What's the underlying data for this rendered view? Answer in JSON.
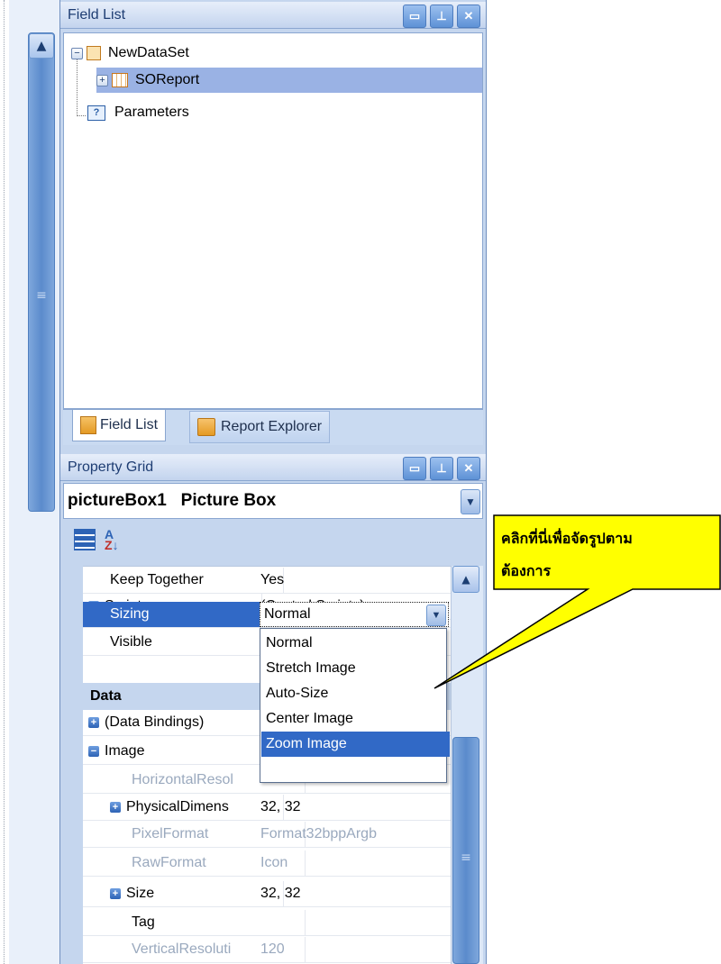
{
  "field_list": {
    "title": "Field List",
    "tree": {
      "dataset": "NewDataSet",
      "table": "SOReport",
      "parameters": "Parameters"
    },
    "tabs": [
      {
        "label": "Field List",
        "active": true
      },
      {
        "label": "Report Explorer",
        "active": false
      }
    ]
  },
  "property_grid": {
    "title": "Property Grid",
    "selected_object": "pictureBox1   Picture Box",
    "rows": {
      "keep_together": {
        "name": "Keep Together",
        "value": "Yes"
      },
      "scripts": {
        "name": "Scripts",
        "value": "(Control Scripts)"
      },
      "sizing": {
        "name": "Sizing",
        "value": "Normal"
      },
      "visible": {
        "name": "Visible",
        "value": ""
      },
      "data_category": "Data",
      "data_bindings": {
        "name": "(Data Bindings)",
        "value": ""
      },
      "image": {
        "name": "Image",
        "value": ""
      },
      "horizontal_resolution": {
        "name": "HorizontalResol",
        "value": ""
      },
      "physical_dimension": {
        "name": "PhysicalDimens",
        "value": "32, 32"
      },
      "pixel_format": {
        "name": "PixelFormat",
        "value": "Format32bppArgb"
      },
      "raw_format": {
        "name": "RawFormat",
        "value": "Icon"
      },
      "size": {
        "name": "Size",
        "value": "32, 32"
      },
      "tag": {
        "name": "Tag",
        "value": ""
      },
      "vertical_resolution": {
        "name": "VerticalResoluti",
        "value": "120"
      }
    },
    "sizing_options": [
      "Normal",
      "Stretch Image",
      "Auto-Size",
      "Center Image",
      "Zoom Image"
    ],
    "sizing_highlighted": "Zoom Image"
  },
  "callout": {
    "line1": "คลิกที่นี่เพื่อจัดรูปตาม",
    "line2": "ต้องการ",
    "fill": "#ffff00"
  }
}
